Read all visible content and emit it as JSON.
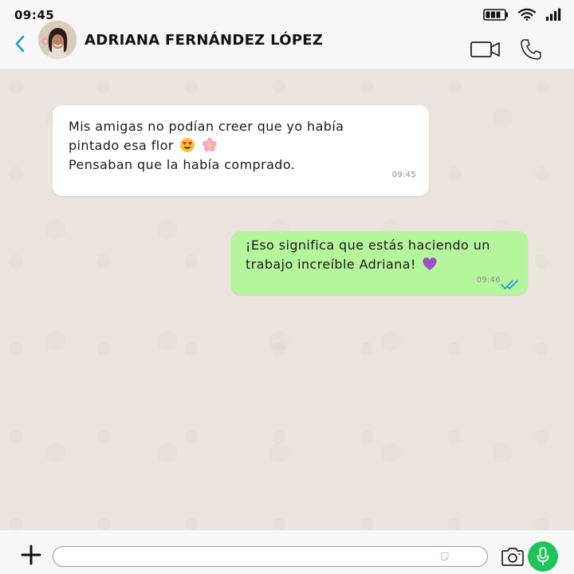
{
  "status_bar": {
    "time": "09:45",
    "icons": [
      "battery-icon",
      "wifi-icon",
      "signal-icon"
    ]
  },
  "header": {
    "contact_name": "ADRIANA FERNÁNDEZ LÓPEZ",
    "icons": [
      "back-icon",
      "avatar",
      "video-call-icon",
      "phone-icon"
    ]
  },
  "messages": [
    {
      "direction": "incoming",
      "lines": [
        "Mis amigas no podían creer que yo había",
        "pintado esa flor",
        "Pensaban que la había comprado."
      ],
      "emojis": [
        "heart-eyes-emoji",
        "cherry-blossom-emoji"
      ],
      "time": "09:45"
    },
    {
      "direction": "outgoing",
      "lines": [
        "¡Eso significa que estás haciendo un",
        "trabajo increíble Adriana!"
      ],
      "emojis": [
        "purple-heart-emoji"
      ],
      "time": "09:46",
      "status": "read-double-check"
    }
  ],
  "composer": {
    "input_value": "",
    "icons": [
      "plus-icon",
      "sticker-icon",
      "camera-icon",
      "microphone-icon"
    ]
  },
  "colors": {
    "accent_blue": "#1a9bd7",
    "outgoing_bubble": "#b5f59b",
    "incoming_bubble": "#ffffff",
    "mic_green": "#1fc35a",
    "chat_background": "#ece5dd"
  }
}
